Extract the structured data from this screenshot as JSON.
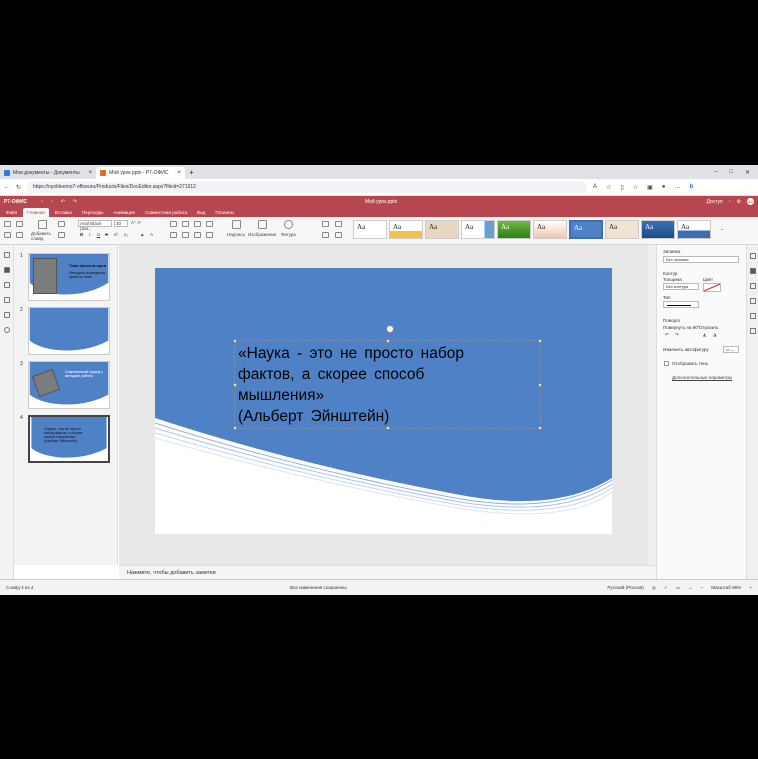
{
  "browser": {
    "tabs": [
      {
        "label": "Мои документы - Документы",
        "icon_color": "#2c7be5"
      },
      {
        "label": "Мой урок.pptx - Р7-ОФИС",
        "icon_color": "#e06b1f"
      }
    ],
    "url": "https://nyobleemo7-offoeuru/Products/Files/DocEditor.aspx?fileid=271912"
  },
  "app": {
    "logo": "Р7-ОФИС",
    "doc_title": "Мой урок.pptx",
    "access": "Доступ",
    "avatar": "АА",
    "brand_color": "#b7474e"
  },
  "menu": {
    "tabs": [
      "Файл",
      "Главная",
      "Вставка",
      "Переходы",
      "Анимация",
      "Совместная работа",
      "Вид",
      "Плагины"
    ],
    "active": "Главная"
  },
  "ribbon": {
    "font_name": "Arial Black (Заг...",
    "font_size": "30",
    "add_slide": "Добавить слайд",
    "caption": "Надпись",
    "image": "Изображение",
    "shape": "Фигура",
    "theme_label": "Aa"
  },
  "slides": [
    {
      "num": "1",
      "title": "Тема проекта идеи",
      "text": "Методика проведения урока по теме"
    },
    {
      "num": "2",
      "title": "",
      "text": ""
    },
    {
      "num": "3",
      "title": "",
      "text": "Современный подход к методике работы"
    },
    {
      "num": "4",
      "title": "",
      "text": "«Наука - это не просто набор фактов, а скорее способ мышления» (Альберт Эйнштейн)"
    }
  ],
  "slide_text": {
    "line1": "«Наука - это не просто набор",
    "line2": "фактов, а скорее способ",
    "line3": "мышления»",
    "line4": "(Альберт Эйнштейн)"
  },
  "notes_placeholder": "Нажмите, чтобы добавить заметки",
  "right_panel": {
    "fill_label": "Заливка",
    "fill_value": "Без заливки",
    "stroke_label": "Контур",
    "size_label": "Толщина",
    "color_label": "Цвет",
    "stroke_value": "Без контура",
    "type_label": "Тип",
    "rotation_label": "Поворот",
    "rotate_label": "Повернуть на 90°",
    "flip_label": "Отразить",
    "autofigure_label": "Изменить автофигуру",
    "shadow_label": "Отображать тень",
    "advanced_label": "Дополнительные параметры"
  },
  "status": {
    "slide_counter": "Слайд 4 из 4",
    "saved": "Все изменения сохранены",
    "language": "Русский (Россия)",
    "zoom": "Масштаб 96%"
  },
  "colors": {
    "slide_blue": "#4f81c7",
    "accent": "#3d6fb4"
  }
}
